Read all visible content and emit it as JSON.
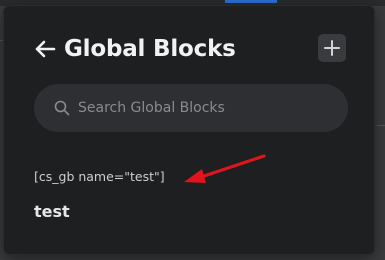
{
  "header": {
    "back_icon": "arrow-left-icon",
    "title": "Global Blocks",
    "add_icon": "plus-icon"
  },
  "search": {
    "icon": "search-icon",
    "placeholder": "Search Global Blocks",
    "value": ""
  },
  "blocks": {
    "shortcode": "[cs_gb name=\"test\"]",
    "items": [
      {
        "label": "test"
      }
    ]
  },
  "annotation": {
    "icon": "red-arrow-icon",
    "color": "#e0141c"
  },
  "colors": {
    "panel_bg": "#1e1f21",
    "search_bg": "#2e2f32",
    "button_bg": "#3a3b3e",
    "title_text": "#f2f2f2",
    "annotation": "#e0141c"
  }
}
